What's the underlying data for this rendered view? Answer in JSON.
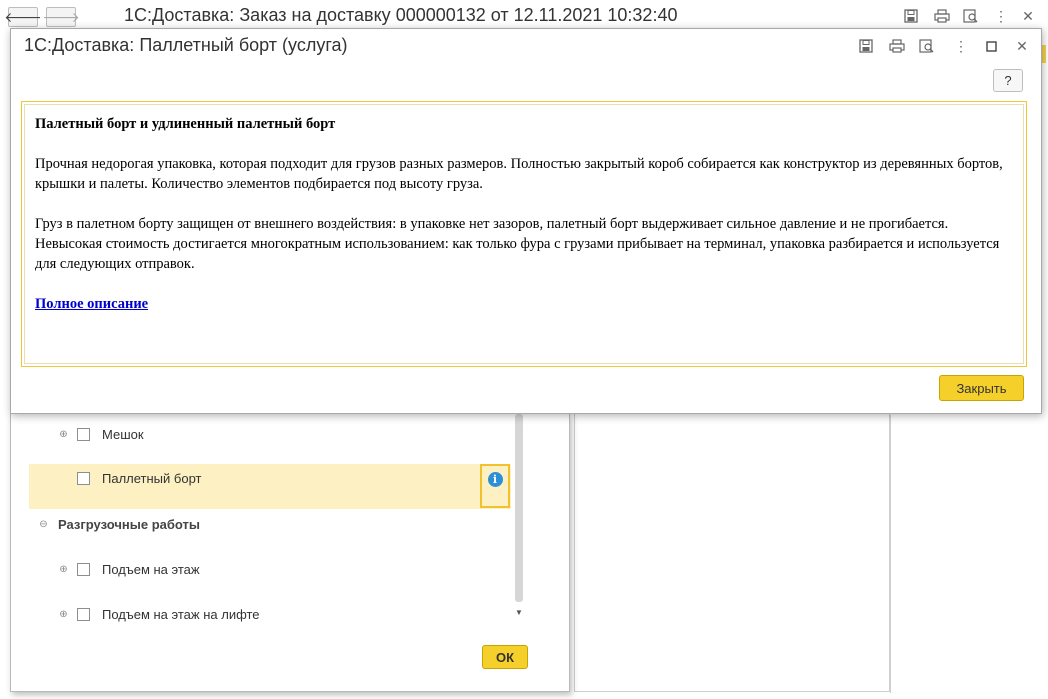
{
  "main_window": {
    "title": "1С:Доставка: Заказ на доставку 000000132 от 12.11.2021 10:32:40",
    "back_icon": "arrow-left-icon",
    "forward_icon": "arrow-right-icon"
  },
  "service_list": {
    "items": [
      {
        "label": "Мешок",
        "type": "item",
        "expander": "⊕"
      },
      {
        "label": "Паллетный борт",
        "type": "item",
        "expander": "",
        "selected": true
      },
      {
        "label": "Разгрузочные работы",
        "type": "group",
        "expander": "⊖"
      },
      {
        "label": "Подъем на этаж",
        "type": "item",
        "expander": "⊕"
      },
      {
        "label": "Подъем на этаж на лифте",
        "type": "item",
        "expander": "⊕"
      }
    ],
    "info_glyph": "i",
    "ok_label": "ОК"
  },
  "dialog": {
    "title": "1С:Доставка: Паллетный борт (услуга)",
    "help_label": "?",
    "heading": "Палетный борт и удлиненный палетный борт",
    "paragraph1": "Прочная недорогая упаковка, которая подходит для грузов разных размеров. Полностью закрытый короб собирается как конструктор из деревянных бортов, крышки и палеты. Количество элементов подбирается под высоту груза.",
    "paragraph2": "Груз в палетном борту защищен от внешнего воздействия: в упаковке нет зазоров, палетный борт выдерживает сильное давление и не прогибается. Невысокая стоимость достигается многократным использованием: как только фура с грузами прибывает на терминал, упаковка разбирается и используется для следующих отправок.",
    "link_label": "Полное описание",
    "close_label": "Закрыть"
  },
  "colors": {
    "accent_button": "#f6d02a",
    "selection": "#fdf0c2",
    "info_icon": "#2d8fd5",
    "link": "#0000cc"
  }
}
